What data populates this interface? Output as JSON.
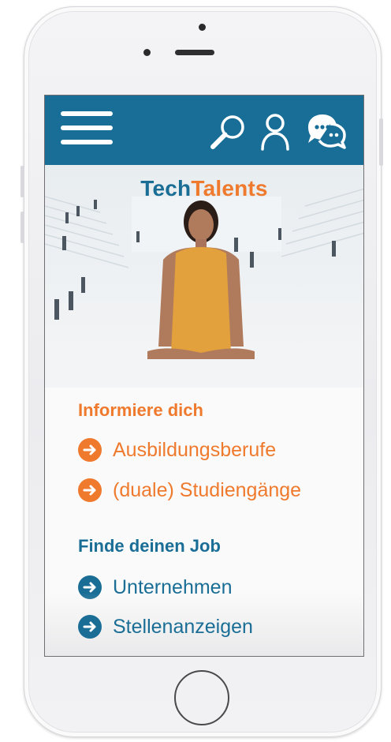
{
  "colors": {
    "header_blue": "#186e97",
    "accent_orange": "#ef7a2d",
    "link_blue": "#1a6e96"
  },
  "header": {
    "icons": [
      "menu-icon",
      "search-icon",
      "user-icon",
      "chat-icon"
    ]
  },
  "hero": {
    "brand_part1": "Tech",
    "brand_part2": "Talents"
  },
  "section_info": {
    "title": "Informiere dich",
    "links": [
      {
        "label": "Ausbildungsberufe",
        "icon": "arrow-right-circle-icon"
      },
      {
        "label": "(duale) Studiengänge",
        "icon": "arrow-right-circle-icon"
      }
    ]
  },
  "section_jobs": {
    "title": "Finde deinen Job",
    "links": [
      {
        "label": "Unternehmen",
        "icon": "arrow-right-circle-icon"
      },
      {
        "label": "Stellenanzeigen",
        "icon": "arrow-right-circle-icon"
      }
    ]
  }
}
